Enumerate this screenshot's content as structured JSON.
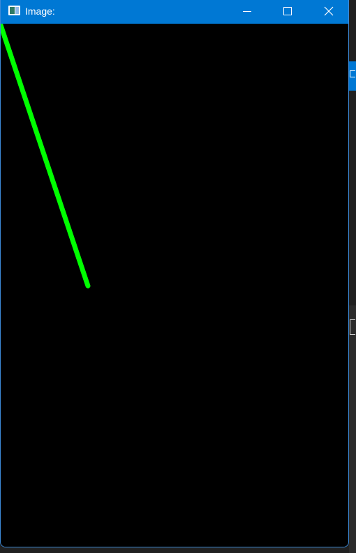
{
  "window": {
    "title": "Image:",
    "app_icon": "image-window-icon",
    "controls": {
      "minimize_icon": "minimize-icon",
      "maximize_icon": "maximize-icon",
      "close_icon": "close-icon"
    },
    "titlebar_color": "#0078d4"
  },
  "canvas": {
    "background": "#000000",
    "line_color": "#00ff00"
  }
}
